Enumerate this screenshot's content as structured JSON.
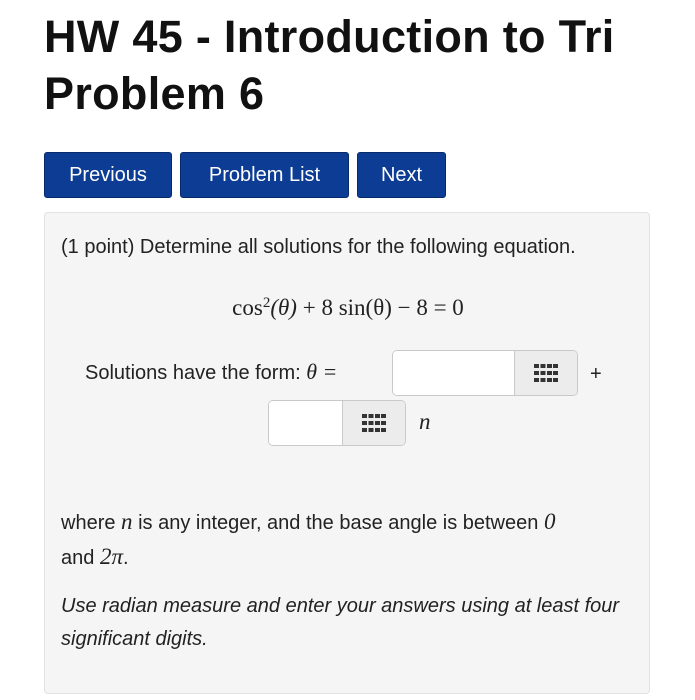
{
  "title": {
    "line1": "HW 45 - Introduction to Tri",
    "line2": "Problem 6"
  },
  "nav": {
    "previous": "Previous",
    "problem_list": "Problem List",
    "next": "Next"
  },
  "problem": {
    "statement": "(1 point) Determine all solutions for the following equation.",
    "equation": {
      "term1": "cos",
      "power": "2",
      "arg1": "(θ)",
      "rest": " + 8 sin(θ) − 8 = 0"
    },
    "form_label": "Solutions have the form:",
    "theta_eq": "θ =",
    "answer1": {
      "value": "",
      "placeholder": ""
    },
    "plus": "+",
    "answer2": {
      "value": "",
      "placeholder": ""
    },
    "n_symbol": "n",
    "where": {
      "part1": "where ",
      "n": "n",
      "part2": " is any integer, and the base angle is between ",
      "zero": "0",
      "part3": "and ",
      "two_pi": "2π",
      "part4": "."
    },
    "note": "Use radian measure and enter your answers using at least four significant digits."
  },
  "icons": {
    "equation_editor": "grid-icon"
  },
  "colors": {
    "button_bg": "#0c3c93",
    "panel_bg": "#f5f5f5"
  }
}
